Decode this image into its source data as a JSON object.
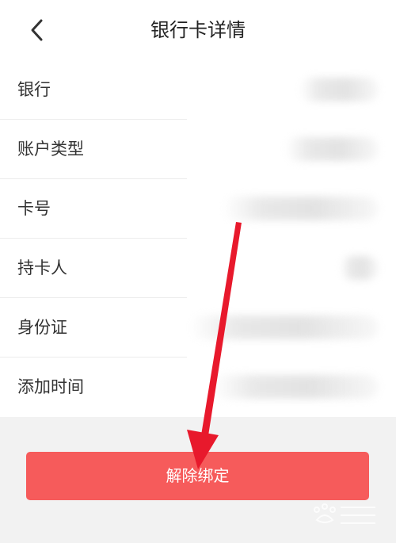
{
  "header": {
    "title": "银行卡详情",
    "back_icon": "chevron-left-icon"
  },
  "rows": [
    {
      "label": "银行"
    },
    {
      "label": "账户类型"
    },
    {
      "label": "卡号"
    },
    {
      "label": "持卡人"
    },
    {
      "label": "身份证"
    },
    {
      "label": "添加时间"
    }
  ],
  "actions": {
    "unbind_label": "解除绑定"
  },
  "colors": {
    "accent": "#f65b5b",
    "annotation": "#e8192c"
  },
  "overlay": {
    "annotation_icon": "red-arrow-icon",
    "watermark_icon": "baidu-jingyan-watermark-icon"
  }
}
